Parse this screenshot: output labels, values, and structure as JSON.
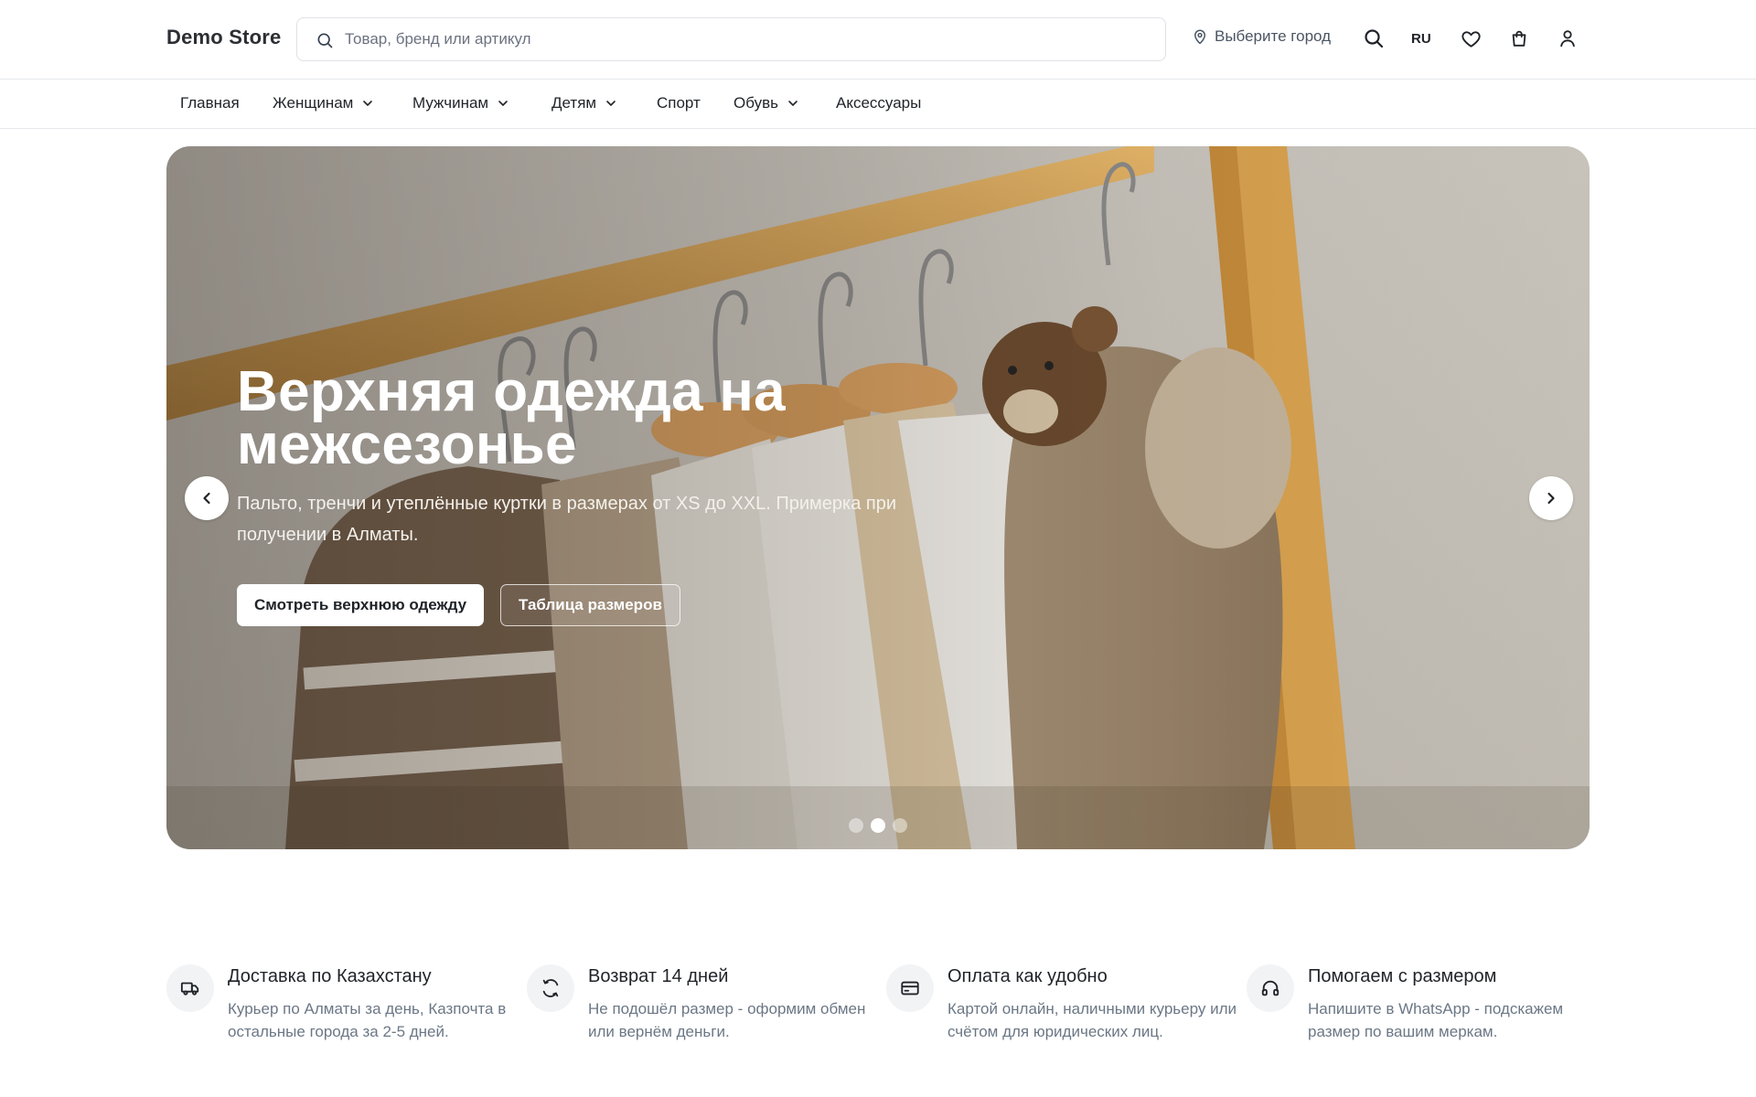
{
  "header": {
    "logo": "Demo Store",
    "search_placeholder": "Товар, бренд или артикул",
    "city_label": "Выберите город",
    "lang": "RU"
  },
  "icons": {
    "search": "search-icon",
    "location": "map-pin-icon",
    "wishlist": "heart-icon",
    "cart": "shopping-bag-icon",
    "account": "user-icon",
    "chevron": "chevron-down-icon"
  },
  "nav": {
    "items": [
      {
        "label": "Главная",
        "dropdown": false
      },
      {
        "label": "Женщинам",
        "dropdown": true
      },
      {
        "label": "Мужчинам",
        "dropdown": true
      },
      {
        "label": "Детям",
        "dropdown": true
      },
      {
        "label": "Спорт",
        "dropdown": false
      },
      {
        "label": "Обувь",
        "dropdown": true
      },
      {
        "label": "Аксессуары",
        "dropdown": false
      }
    ]
  },
  "hero": {
    "title": "Верхняя одежда на межсезонье",
    "subtitle": "Пальто, тренчи и утеплённые куртки в размерах от XS до XXL. Примерка при получении в Алматы.",
    "primary_button": "Смотреть верхнюю одежду",
    "secondary_button": "Таблица размеров",
    "slide_count": 3,
    "active_slide": 2
  },
  "features": [
    {
      "icon": "truck-icon",
      "title": "Доставка по Казахстану",
      "text": "Курьер по Алматы за день, Казпочта в остальные города за 2-5 дней."
    },
    {
      "icon": "refresh-icon",
      "title": "Возврат 14 дней",
      "text": "Не подошёл размер - оформим обмен или вернём деньги."
    },
    {
      "icon": "credit-card-icon",
      "title": "Оплата как удобно",
      "text": "Картой онлайн, наличными курьеру или счётом для юридических лиц."
    },
    {
      "icon": "headphones-icon",
      "title": "Помогаем с размером",
      "text": "Напишите в WhatsApp - подскажем размер по вашим меркам."
    }
  ],
  "colors": {
    "text": "#1f2328",
    "muted": "#6b7785",
    "border": "#e5e7eb",
    "icon_bg": "#f1f3f5"
  }
}
